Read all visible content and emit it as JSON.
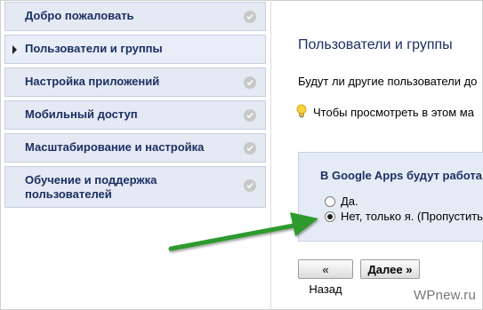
{
  "nav": {
    "items": [
      {
        "label": "Добро пожаловать",
        "active": false
      },
      {
        "label": "Пользователи и группы",
        "active": true
      },
      {
        "label": "Настройка приложений",
        "active": false
      },
      {
        "label": "Мобильный доступ",
        "active": false
      },
      {
        "label": "Масштабирование и настройка",
        "active": false
      },
      {
        "label": "Обучение и поддержка пользователей",
        "active": false
      }
    ]
  },
  "main": {
    "title": "Пользователи и группы",
    "question": "Будут ли другие пользователи до",
    "hint": "Чтобы просмотреть в этом ма",
    "options_heading": "В Google Apps будут работа",
    "options": [
      {
        "label": "Да.",
        "checked": false
      },
      {
        "label": "Нет, только я. (Пропустить",
        "checked": true
      }
    ],
    "back_label": "« Назад",
    "next_label": "Далее »"
  },
  "watermark": "WPnew.ru",
  "colors": {
    "nav_bg": "#e4e9f3",
    "nav_text": "#1c2f63",
    "box_bg": "#e5ebf5",
    "arrow": "#2e8b2e"
  },
  "icons": {
    "nav_check": "check-circle-icon",
    "nav_active": "triangle-right-icon",
    "hint": "lightbulb-icon"
  }
}
